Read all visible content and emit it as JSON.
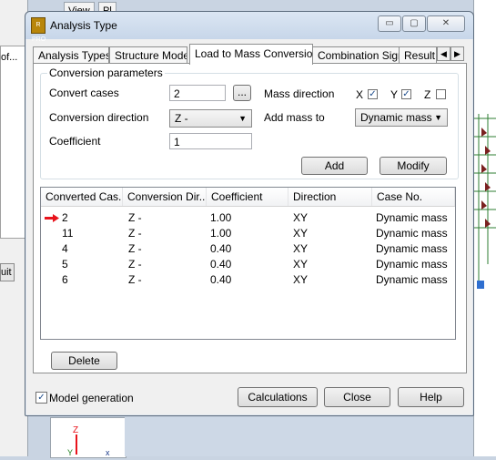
{
  "background": {
    "left_text": "of...",
    "left_button": "uit",
    "top_tabs": [
      "View",
      "Pl"
    ]
  },
  "dialog": {
    "title": "Analysis Type",
    "icon_text": "R PRO",
    "window_buttons": {
      "minimize": "▭",
      "restore": "▢",
      "close": "✕"
    },
    "tabs": [
      "Analysis Types",
      "Structure Model",
      "Load to Mass Conversion",
      "Combination Sign",
      "Result F"
    ],
    "active_tab": "Load to Mass Conversion",
    "tab_scroll": {
      "left": "◀",
      "right": "▶"
    },
    "conversion": {
      "group_title": "Conversion parameters",
      "convert_cases_label": "Convert cases",
      "convert_cases_value": "2",
      "browse_button": "...",
      "conversion_direction_label": "Conversion direction",
      "conversion_direction_value": "Z -",
      "coefficient_label": "Coefficient",
      "coefficient_value": "1",
      "mass_direction_label": "Mass direction",
      "mass_x_label": "X",
      "mass_x_checked": true,
      "mass_y_label": "Y",
      "mass_y_checked": true,
      "mass_z_label": "Z",
      "mass_z_checked": false,
      "add_mass_to_label": "Add mass to",
      "add_mass_to_value": "Dynamic mass",
      "add_button": "Add",
      "modify_button": "Modify"
    },
    "table": {
      "columns": [
        "Converted Cas...",
        "Conversion Dir...",
        "Coefficient",
        "Direction",
        "Case No."
      ],
      "rows": [
        {
          "case": "2",
          "direction_conv": "Z -",
          "coefficient": "1.00",
          "direction": "XY",
          "case_no": "Dynamic mass",
          "selected": true
        },
        {
          "case": "11",
          "direction_conv": "Z -",
          "coefficient": "1.00",
          "direction": "XY",
          "case_no": "Dynamic mass",
          "selected": false
        },
        {
          "case": "4",
          "direction_conv": "Z -",
          "coefficient": "0.40",
          "direction": "XY",
          "case_no": "Dynamic mass",
          "selected": false
        },
        {
          "case": "5",
          "direction_conv": "Z -",
          "coefficient": "0.40",
          "direction": "XY",
          "case_no": "Dynamic mass",
          "selected": false
        },
        {
          "case": "6",
          "direction_conv": "Z -",
          "coefficient": "0.40",
          "direction": "XY",
          "case_no": "Dynamic mass",
          "selected": false
        }
      ]
    },
    "delete_button": "Delete",
    "model_generation_label": "Model generation",
    "model_generation_checked": true,
    "calculations_button": "Calculations",
    "close_button": "Close",
    "help_button": "Help"
  },
  "colors": {
    "pointer": "#e8141c",
    "accent_icon": "#b8860b",
    "structure": "#7a2020"
  }
}
